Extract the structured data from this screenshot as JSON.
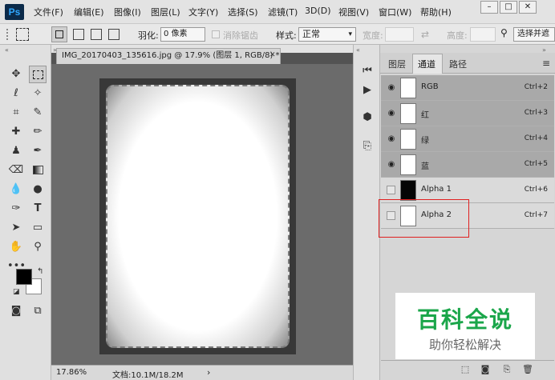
{
  "app": {
    "logo": "Ps"
  },
  "menu": [
    "文件(F)",
    "编辑(E)",
    "图像(I)",
    "图层(L)",
    "文字(Y)",
    "选择(S)",
    "滤镜(T)",
    "3D(D)",
    "视图(V)",
    "窗口(W)",
    "帮助(H)"
  ],
  "window_buttons": {
    "minimize": "–",
    "maximize": "□",
    "close": "✕"
  },
  "options": {
    "feather_label": "羽化:",
    "feather_value": "0 像素",
    "antialias_label": "消除锯齿",
    "style_label": "样式:",
    "style_value": "正常",
    "width_label": "宽度:",
    "height_label": "高度:",
    "select_mask_button": "选择并遮"
  },
  "document": {
    "tab_title": "IMG_20170403_135616.jpg @ 17.9% (图层 1, RGB/8) *",
    "close_glyph": "✕"
  },
  "status": {
    "zoom": "17.86%",
    "doc_info": "文档:10.1M/18.2M",
    "arrow": "›"
  },
  "panel": {
    "tabs": [
      "图层",
      "通道",
      "路径"
    ],
    "active_tab": "通道",
    "menu_glyph": "≡",
    "channels": [
      {
        "name": "RGB",
        "shortcut": "Ctrl+2",
        "visible": true,
        "thumb": "white"
      },
      {
        "name": "红",
        "shortcut": "Ctrl+3",
        "visible": true,
        "thumb": "white"
      },
      {
        "name": "绿",
        "shortcut": "Ctrl+4",
        "visible": true,
        "thumb": "white"
      },
      {
        "name": "蓝",
        "shortcut": "Ctrl+5",
        "visible": true,
        "thumb": "white"
      },
      {
        "name": "Alpha 1",
        "shortcut": "Ctrl+6",
        "visible": false,
        "thumb": "black"
      },
      {
        "name": "Alpha 2",
        "shortcut": "Ctrl+7",
        "visible": false,
        "thumb": "white"
      }
    ]
  },
  "watermark": {
    "title": "百科全说",
    "subtitle": "助你轻松解决"
  },
  "colors": {
    "accent_red": "#e02020",
    "watermark_green": "#1aa64a"
  }
}
